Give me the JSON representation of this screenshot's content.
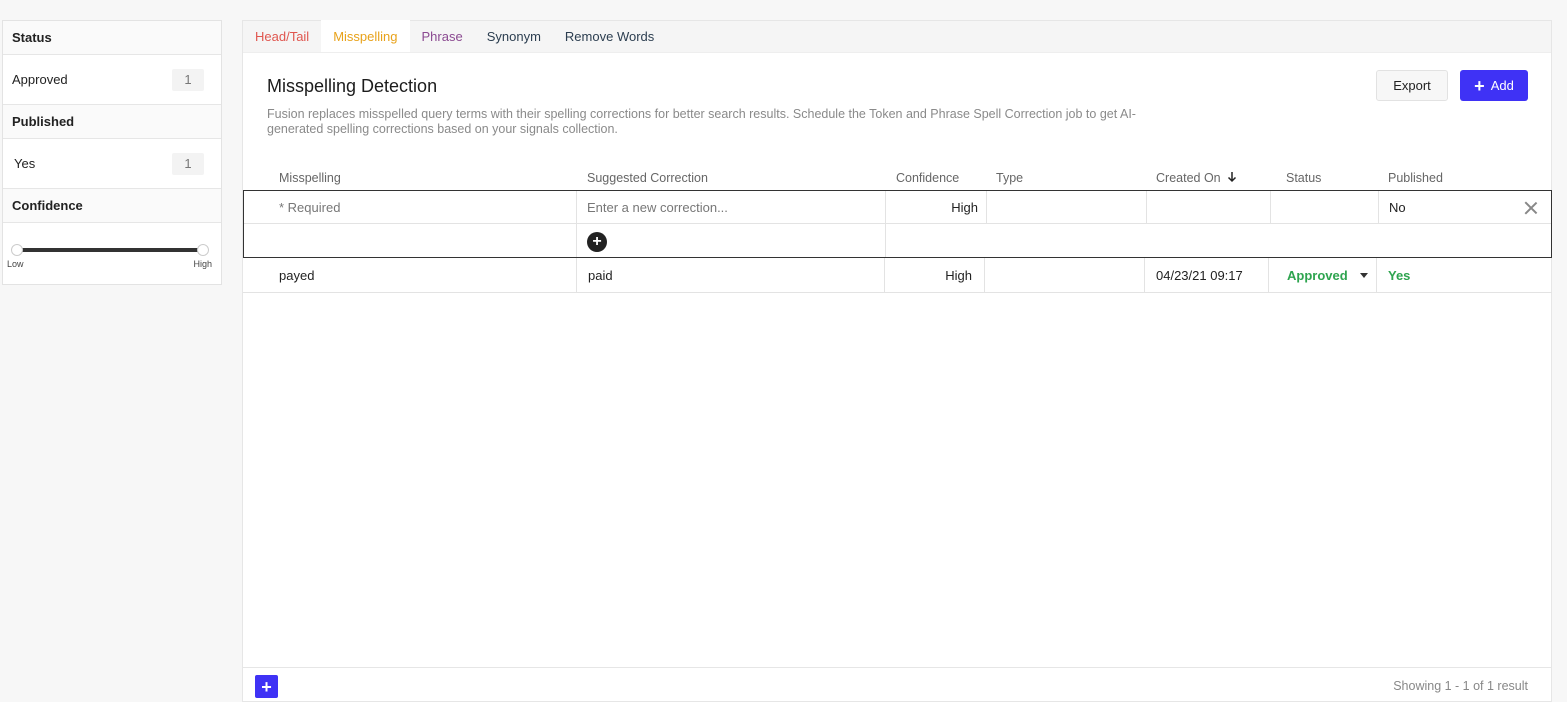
{
  "sidebar": {
    "status": {
      "title": "Status",
      "items": [
        {
          "label": "Approved",
          "count": "1"
        }
      ]
    },
    "published": {
      "title": "Published",
      "items": [
        {
          "label": "Yes",
          "count": "1"
        }
      ]
    },
    "confidence": {
      "title": "Confidence",
      "low_label": "Low",
      "high_label": "High",
      "range": [
        0,
        1
      ]
    }
  },
  "tabs": [
    {
      "label": "Head/Tail"
    },
    {
      "label": "Misspelling",
      "active": true
    },
    {
      "label": "Phrase"
    },
    {
      "label": "Synonym"
    },
    {
      "label": "Remove Words"
    }
  ],
  "page": {
    "title": "Misspelling Detection",
    "description": "Fusion replaces misspelled query terms with their spelling corrections for better search results. Schedule the Token and Phrase Spell Correction job to get AI-generated spelling corrections based on your signals collection.",
    "export_label": "Export",
    "add_label": "Add"
  },
  "table": {
    "columns": [
      "Misspelling",
      "Suggested Correction",
      "Confidence",
      "Type",
      "Created On",
      "Status",
      "Published"
    ],
    "sort_column": "Created On",
    "new_row": {
      "misspelling_placeholder": "* Required",
      "correction_placeholder": "Enter a new correction...",
      "confidence": "High",
      "published": "No"
    },
    "rows": [
      {
        "misspelling": "payed",
        "correction": "paid",
        "confidence": "High",
        "type": "",
        "created_on": "04/23/21 09:17",
        "status": "Approved",
        "published": "Yes"
      }
    ]
  },
  "footer": {
    "showing": "Showing 1 - 1 of 1 result"
  },
  "colors": {
    "accent": "#3f32f5",
    "success": "#2ea44f"
  },
  "icons": {
    "close": "close-icon",
    "add": "plus-circle-icon",
    "sort": "arrow-down-icon",
    "status_dropdown": "caret-down-icon"
  }
}
